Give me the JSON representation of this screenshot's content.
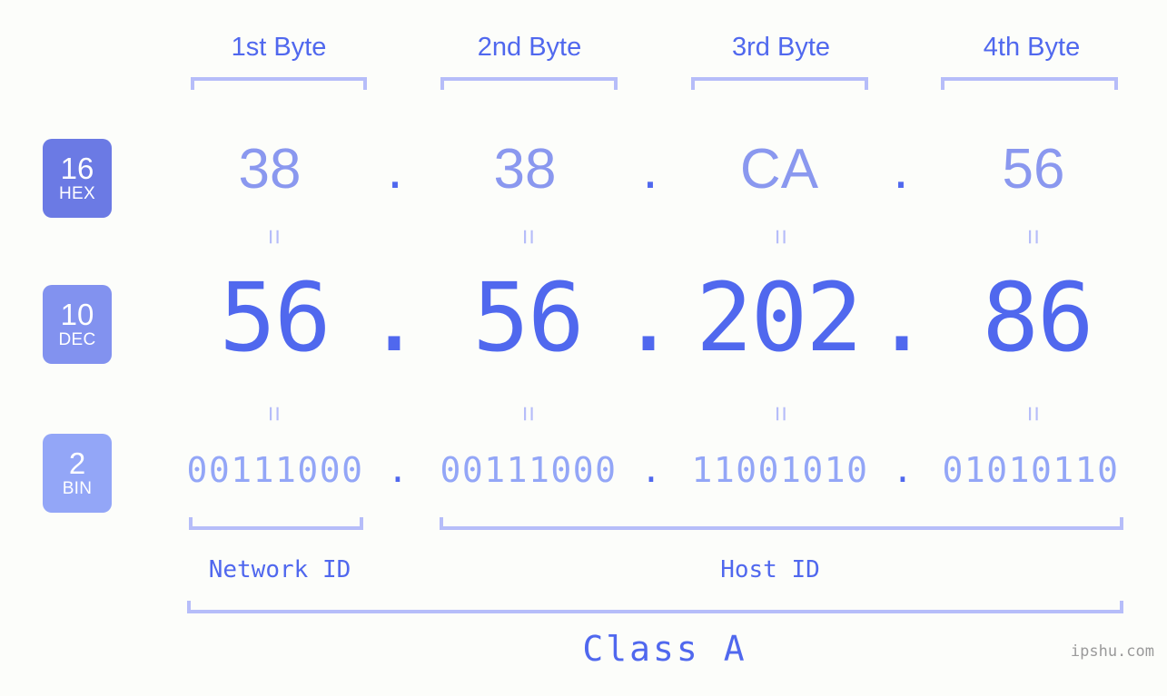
{
  "colors": {
    "background": "#fcfdfa",
    "accent_strong": "#5068ee",
    "accent_mid": "#8a98ef",
    "accent_light": "#93a6f7",
    "bracket": "#b6bdf9",
    "badge_hex": "#6b7ae4",
    "badge_dec": "#8292ef",
    "badge_bin": "#93a6f7",
    "watermark": "#9a9a9a"
  },
  "byte_headers": [
    {
      "label": "1st Byte"
    },
    {
      "label": "2nd Byte"
    },
    {
      "label": "3rd Byte"
    },
    {
      "label": "4th Byte"
    }
  ],
  "radix_badges": [
    {
      "number": "16",
      "word": "HEX"
    },
    {
      "number": "10",
      "word": "DEC"
    },
    {
      "number": "2",
      "word": "BIN"
    }
  ],
  "rows": {
    "hex": {
      "octets": [
        "38",
        "38",
        "CA",
        "56"
      ],
      "separator": "."
    },
    "dec": {
      "octets": [
        "56",
        "56",
        "202",
        "86"
      ],
      "separator": "."
    },
    "bin": {
      "octets": [
        "00111000",
        "00111000",
        "11001010",
        "01010110"
      ],
      "separator": "."
    }
  },
  "equals_connectors": {
    "symbol": "=",
    "count_per_row": 4
  },
  "segments": {
    "network_id": "Network ID",
    "host_id": "Host ID"
  },
  "class": {
    "label": "Class A"
  },
  "watermark": {
    "text": "ipshu.com"
  }
}
